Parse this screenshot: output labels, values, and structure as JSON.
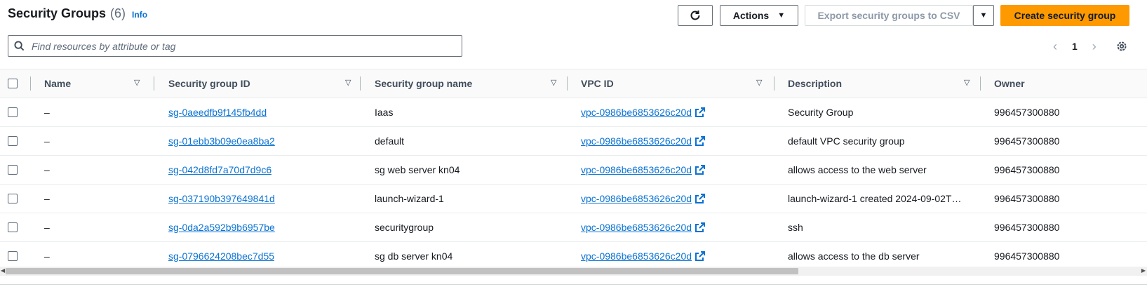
{
  "header": {
    "title": "Security Groups",
    "count": "(6)",
    "info": "Info"
  },
  "toolbar": {
    "actions_label": "Actions",
    "export_label": "Export security groups to CSV",
    "create_label": "Create security group"
  },
  "search": {
    "placeholder": "Find resources by attribute or tag",
    "value": ""
  },
  "pagination": {
    "current_page": "1"
  },
  "table": {
    "columns": [
      "Name",
      "Security group ID",
      "Security group name",
      "VPC ID",
      "Description",
      "Owner"
    ],
    "rows": [
      {
        "name": "–",
        "sg_id": "sg-0aeedfb9f145fb4dd",
        "sg_name": "Iaas",
        "vpc_id": "vpc-0986be6853626c20d",
        "description": "Security Group",
        "owner": "996457300880"
      },
      {
        "name": "–",
        "sg_id": "sg-01ebb3b09e0ea8ba2",
        "sg_name": "default",
        "vpc_id": "vpc-0986be6853626c20d",
        "description": "default VPC security group",
        "owner": "996457300880"
      },
      {
        "name": "–",
        "sg_id": "sg-042d8fd7a70d7d9c6",
        "sg_name": "sg web server kn04",
        "vpc_id": "vpc-0986be6853626c20d",
        "description": "allows access to the web server",
        "owner": "996457300880"
      },
      {
        "name": "–",
        "sg_id": "sg-037190b397649841d",
        "sg_name": "launch-wizard-1",
        "vpc_id": "vpc-0986be6853626c20d",
        "description": "launch-wizard-1 created 2024-09-02T…",
        "owner": "996457300880"
      },
      {
        "name": "–",
        "sg_id": "sg-0da2a592b9b6957be",
        "sg_name": "securitygroup",
        "vpc_id": "vpc-0986be6853626c20d",
        "description": "ssh",
        "owner": "996457300880"
      },
      {
        "name": "–",
        "sg_id": "sg-0796624208bec7d55",
        "sg_name": "sg db server kn04",
        "vpc_id": "vpc-0986be6853626c20d",
        "description": "allows access to the db server",
        "owner": "996457300880"
      }
    ]
  },
  "colors": {
    "accent": "#ff9900",
    "link": "#0972d3",
    "text": "#16191f"
  },
  "icons": [
    "refresh-icon",
    "caret-down-icon",
    "search-icon",
    "chevron-left-icon",
    "chevron-right-icon",
    "gear-icon",
    "external-link-icon",
    "sort-icon"
  ]
}
